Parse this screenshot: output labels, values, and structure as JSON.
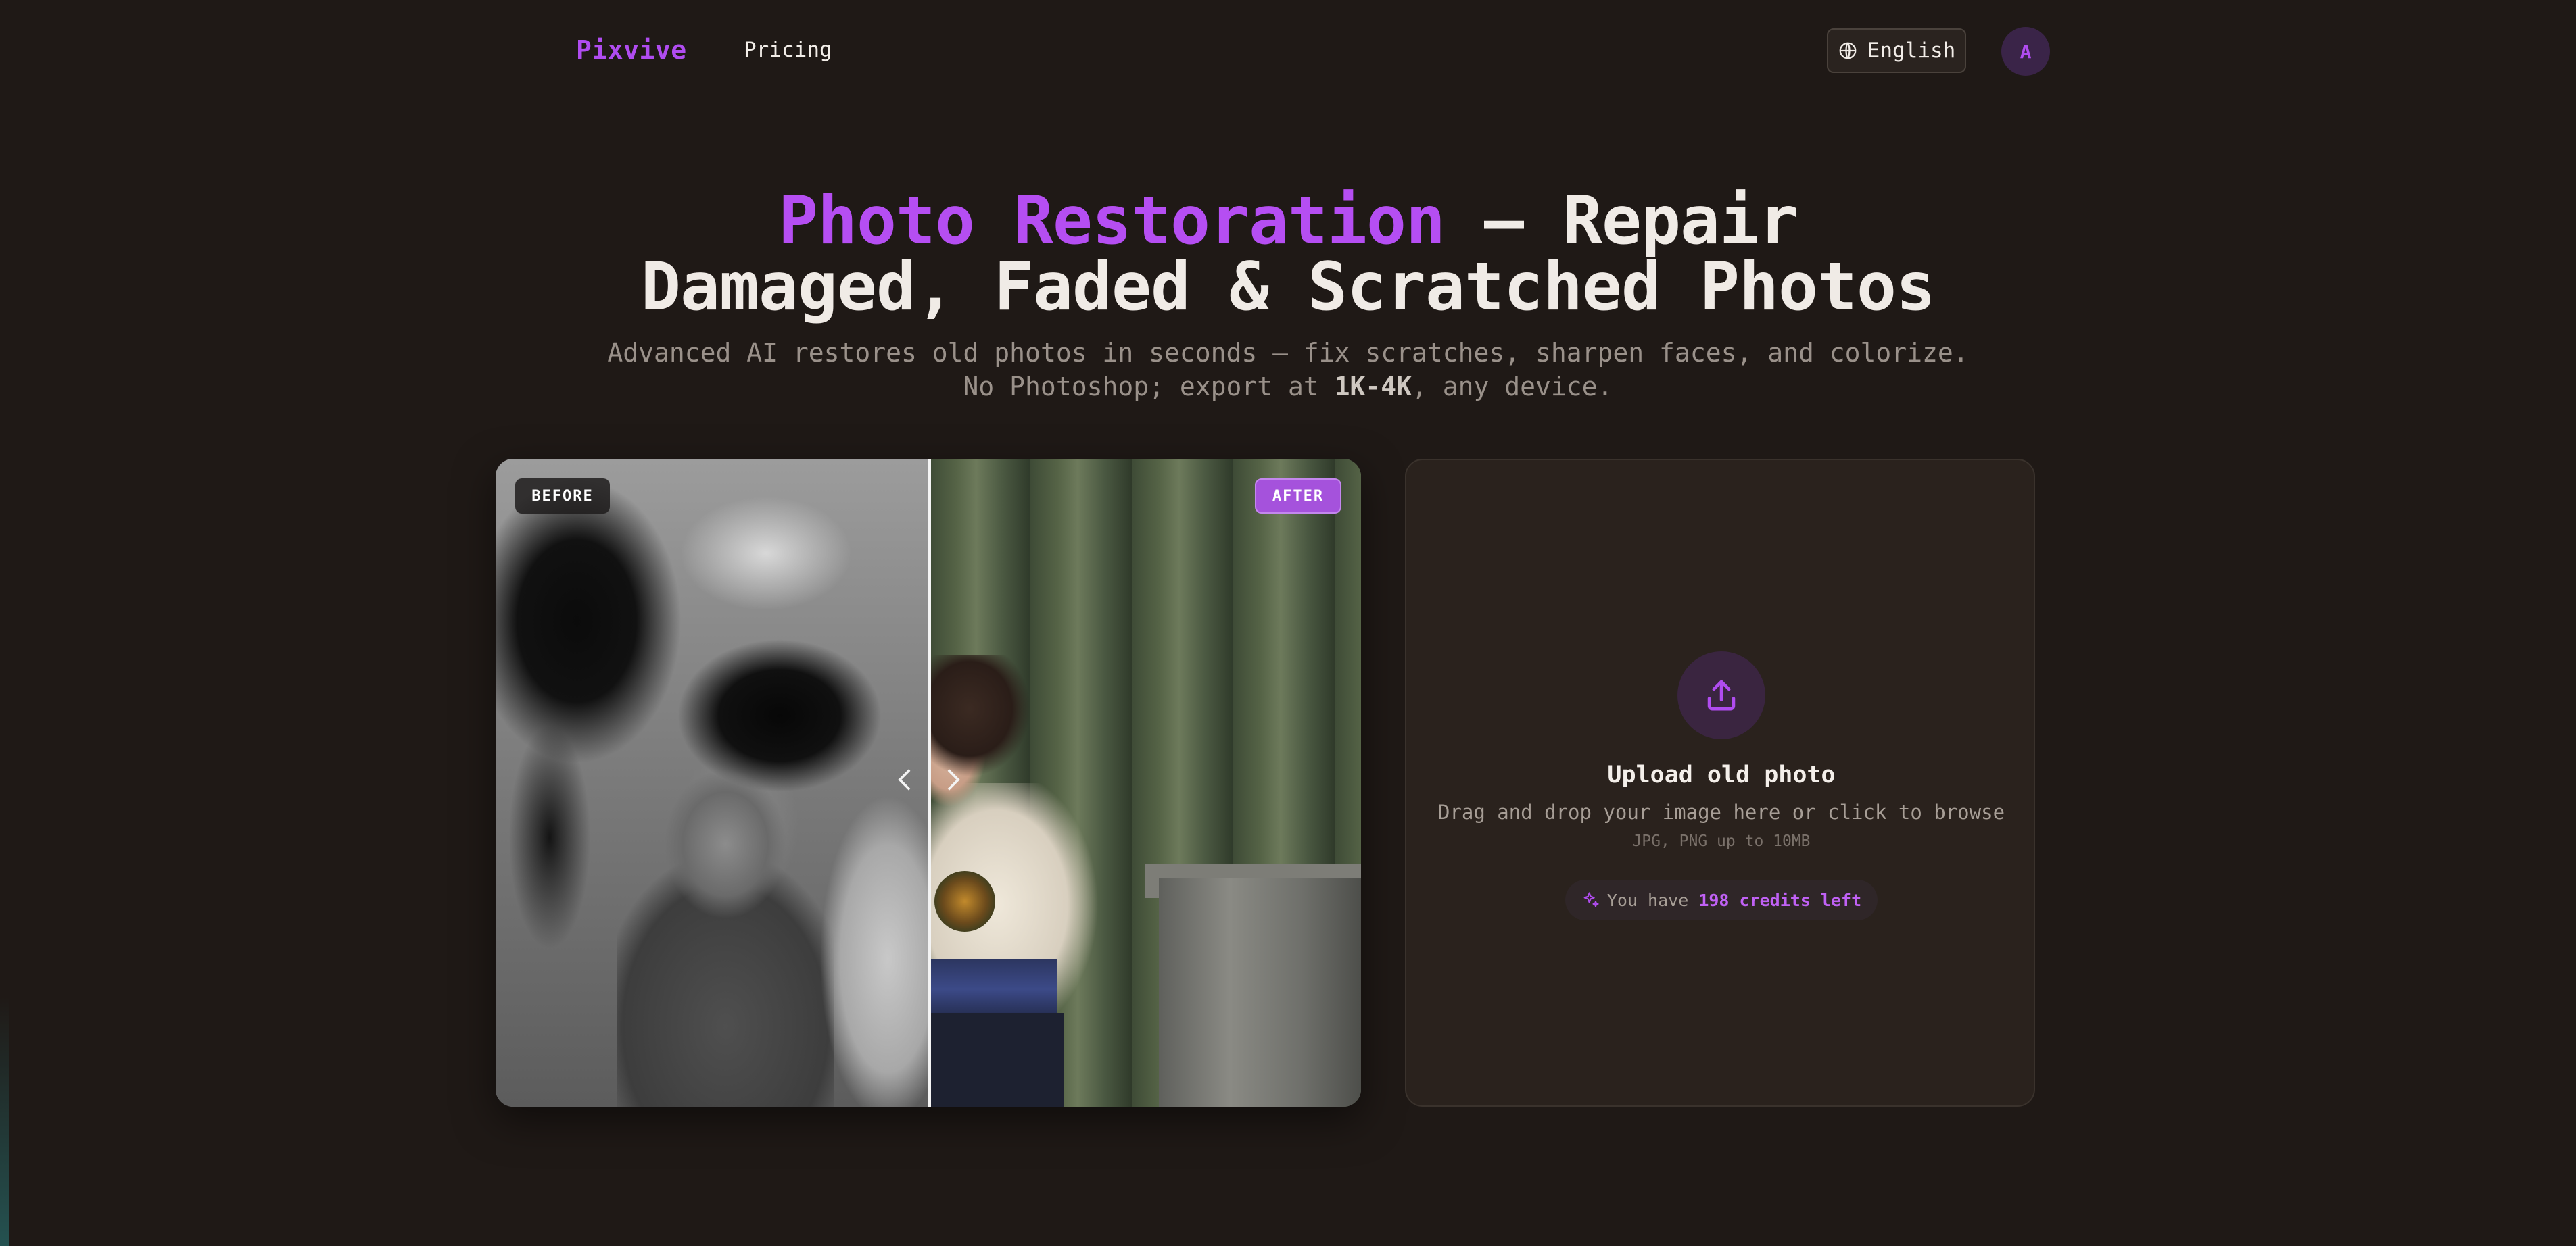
{
  "nav": {
    "logo": "Pixvive",
    "links": [
      "Pricing"
    ],
    "language": "English",
    "avatar_initial": "A"
  },
  "hero": {
    "title_accent": "Photo Restoration",
    "title_rest_line1": " — Repair",
    "title_line2": "Damaged, Faded & Scratched Photos",
    "subtitle_pre": "Advanced AI restores old photos in seconds — fix scratches, sharpen faces, and colorize. No Photoshop; export at ",
    "subtitle_bold": "1K-4K",
    "subtitle_post": ", any device."
  },
  "compare": {
    "before_label": "BEFORE",
    "after_label": "AFTER",
    "slider_position": 0.5
  },
  "upload": {
    "icon": "upload-icon",
    "title": "Upload old photo",
    "description": "Drag and drop your image here or click to browse",
    "formats": "JPG, PNG up to 10MB",
    "credits_prefix": "You have ",
    "credits_value": "198 credits left"
  },
  "colors": {
    "background": "#1f1916",
    "accent": "#b04cf0",
    "card": "#2a221d"
  }
}
